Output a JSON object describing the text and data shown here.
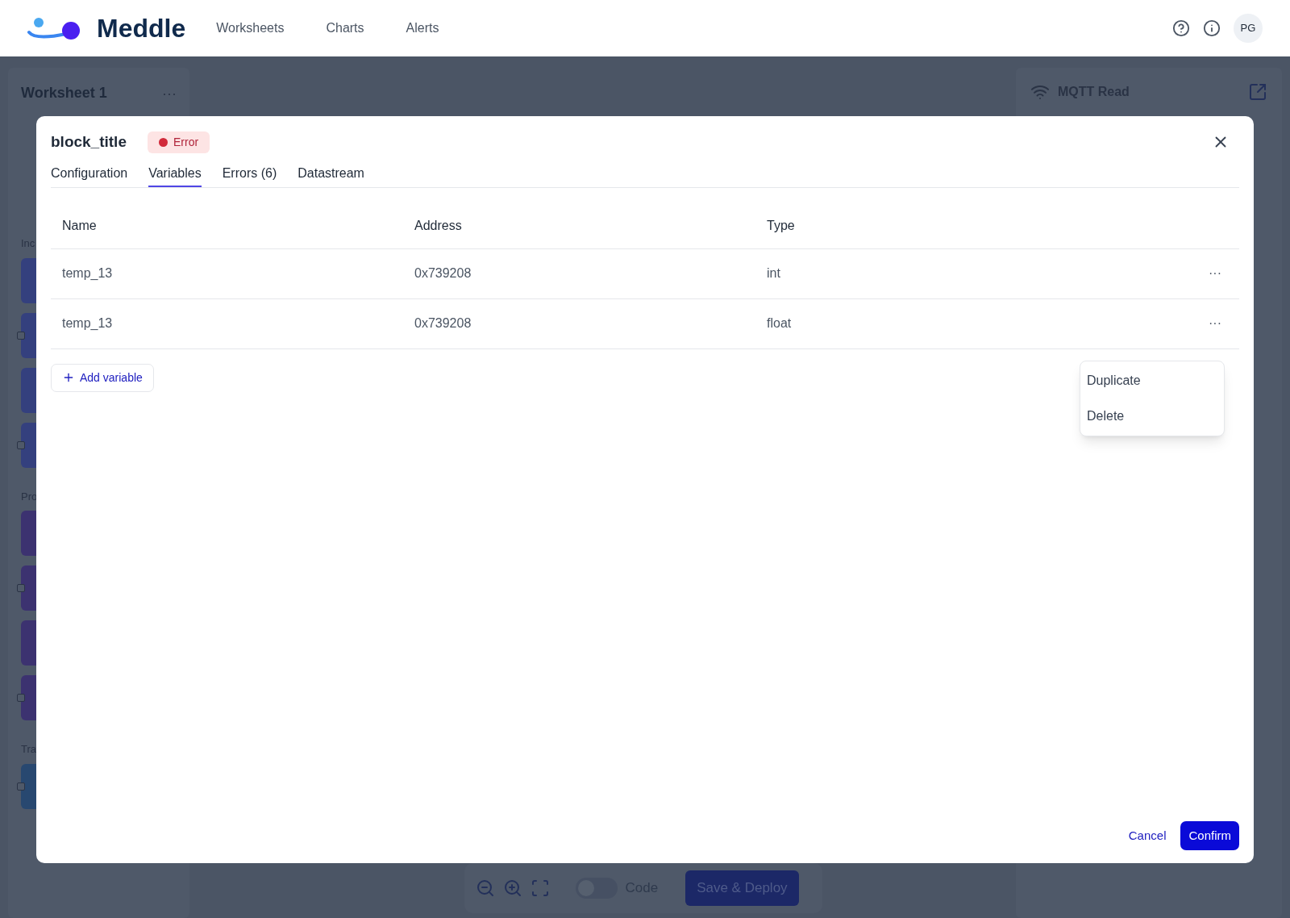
{
  "header": {
    "logo_text": "Meddle",
    "nav": [
      {
        "label": "Worksheets",
        "selected": false
      },
      {
        "label": "Charts",
        "selected": false
      },
      {
        "label": "Alerts",
        "selected": false
      }
    ],
    "avatar": "PG"
  },
  "worksheet": {
    "title": "Worksheet 1",
    "more_icon": "···",
    "sections": [
      {
        "label": "Inc",
        "color": "#34407e",
        "blocks": [
          {
            "connector": false
          },
          {
            "connector": true
          },
          {
            "connector": false
          },
          {
            "connector": true
          }
        ]
      },
      {
        "label": "Pro",
        "color": "#3c3270",
        "blocks": [
          {
            "connector": false
          },
          {
            "connector": true
          },
          {
            "connector": false
          },
          {
            "connector": true
          }
        ]
      },
      {
        "label": "Tra",
        "color": "#284870",
        "blocks": [
          {
            "connector": true
          }
        ]
      }
    ]
  },
  "right_panel": {
    "title": "MQTT Read"
  },
  "toolbar": {
    "code_label": "Code",
    "code_on": false,
    "deploy_label": "Save & Deploy"
  },
  "dialog": {
    "title": "block_title",
    "status": {
      "kind": "error",
      "label": "Error"
    },
    "tabs": [
      {
        "label": "Configuration",
        "selected": false
      },
      {
        "label": "Variables",
        "selected": true
      },
      {
        "label": "Errors (6)",
        "selected": false
      },
      {
        "label": "Datastream",
        "selected": false
      }
    ],
    "columns": [
      "Name",
      "Address",
      "Type"
    ],
    "rows": [
      {
        "name": "temp_13",
        "address": "0x739208",
        "type": "int",
        "menu_icon": "···"
      },
      {
        "name": "temp_13",
        "address": "0x739208",
        "type": "float",
        "menu_icon": "···"
      }
    ],
    "menu_items": [
      "Duplicate",
      "Delete"
    ],
    "add_label": "Add variable",
    "cancel_label": "Cancel",
    "confirm_label": "Confirm"
  }
}
